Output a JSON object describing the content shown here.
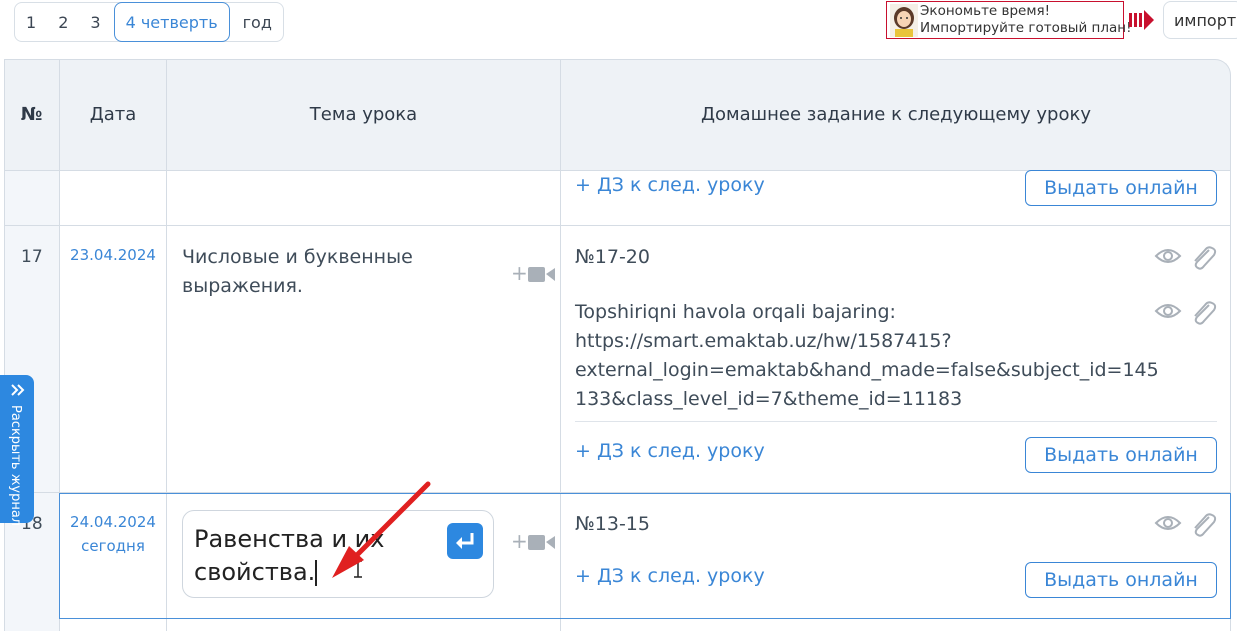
{
  "tabs": {
    "t1": "1",
    "t2": "2",
    "t3": "3",
    "t4": "4 четверть",
    "t5": "год"
  },
  "promo": {
    "line1": "Экономьте время!",
    "line2": "Импортируйте готовый план!"
  },
  "import_label": "импорт",
  "headers": {
    "num": "№",
    "date": "Дата",
    "topic": "Тема урока",
    "homework": "Домашнее задание к следующему уроку"
  },
  "partial_row": {
    "add_hw": "+ ДЗ к след. уроку",
    "give_online": "Выдать онлайн"
  },
  "row17": {
    "num": "17",
    "date": "23.04.2024",
    "topic": "Числовые и буквенные выражения.",
    "hw1": "№17-20",
    "hw2_line1": "Topshiriqni havola orqali bajaring:",
    "hw2_line2": "https://smart.emaktab.uz/hw/1587415?",
    "hw2_line3": "external_login=emaktab&hand_made=false&subject_id=145",
    "hw2_line4": "133&class_level_id=7&theme_id=11183",
    "add_hw": "+ ДЗ к след. уроку",
    "give_online": "Выдать онлайн"
  },
  "row18": {
    "num": "18",
    "date": "24.04.2024",
    "today": "сегодня",
    "topic_input_line1": "Равенства и их",
    "topic_input_line2": "свойства.",
    "hw1": "№13-15",
    "add_hw": "+ ДЗ к след. уроку",
    "give_online": "Выдать онлайн"
  },
  "side_tab": "Раскрыть журнал",
  "colors": {
    "accent": "#3a86d6",
    "header_bg": "#eef2f6",
    "promo_border": "#c8102e",
    "arrow": "#e02020"
  }
}
